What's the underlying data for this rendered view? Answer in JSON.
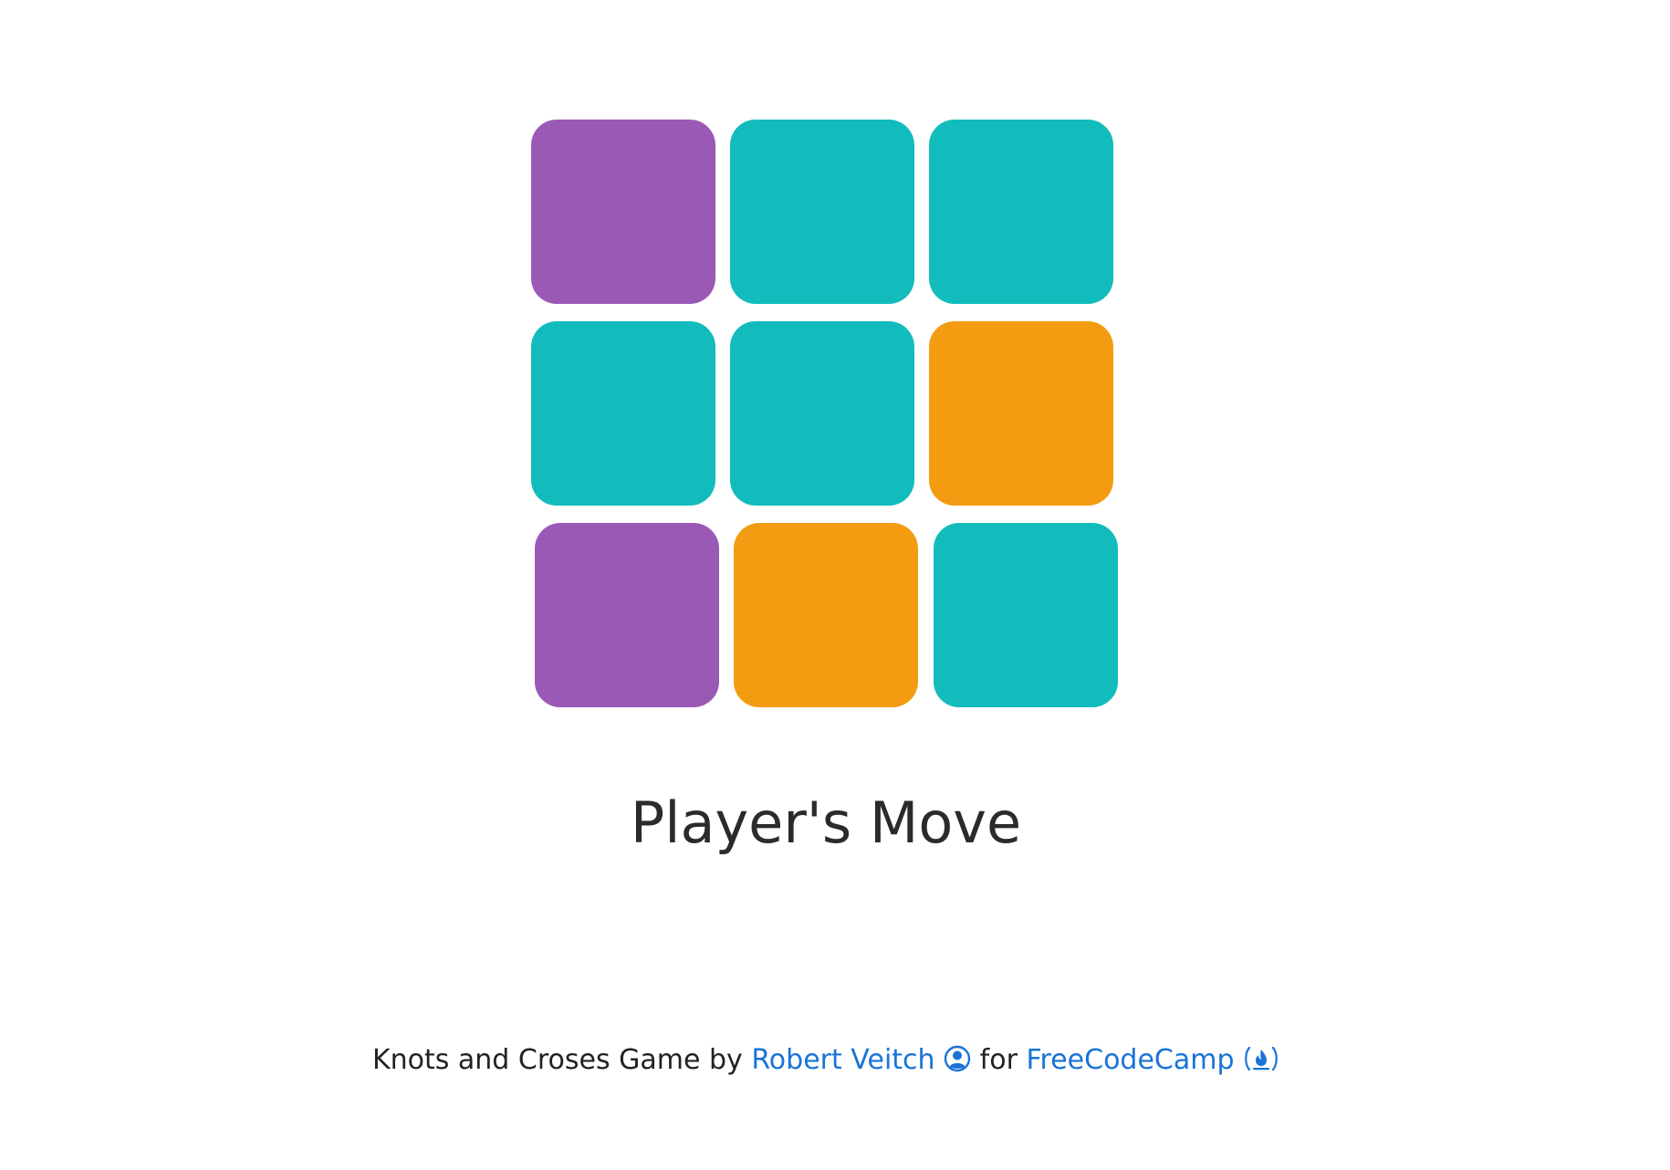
{
  "board": {
    "tiles": [
      {
        "state": "purple",
        "color": "#9b59b6"
      },
      {
        "state": "teal",
        "color": "#12bcbc"
      },
      {
        "state": "teal",
        "color": "#12bcbc"
      },
      {
        "state": "teal",
        "color": "#12bcbc"
      },
      {
        "state": "teal",
        "color": "#12bcbc"
      },
      {
        "state": "orange",
        "color": "#f39c12"
      },
      {
        "state": "purple",
        "color": "#9b59b6"
      },
      {
        "state": "orange",
        "color": "#f39c12"
      },
      {
        "state": "teal",
        "color": "#12bcbc"
      }
    ]
  },
  "status": {
    "text": "Player's Move"
  },
  "footer": {
    "prefix": "Knots and Croses Game by",
    "author_link": "Robert Veitch",
    "author_icon": "user-circle-icon",
    "middle": "for",
    "org_link": "FreeCodeCamp",
    "org_icon": "fire-icon",
    "link_color": "#1a73d6"
  }
}
